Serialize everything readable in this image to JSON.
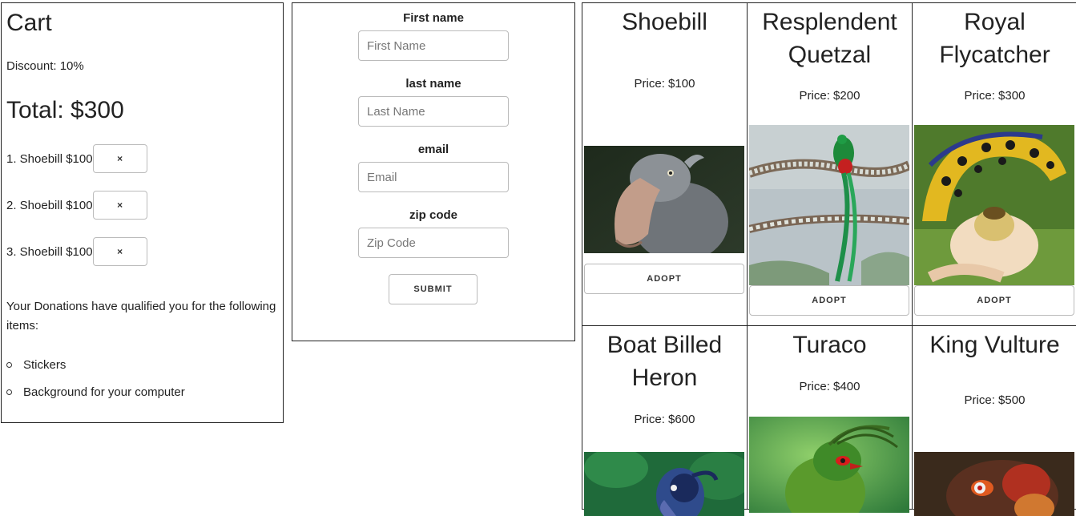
{
  "cart": {
    "title": "Cart",
    "discount": "Discount: 10%",
    "total": "Total: $300",
    "remove_symbol": "×",
    "items": [
      {
        "label": "1. Shoebill $100"
      },
      {
        "label": "2. Shoebill $100"
      },
      {
        "label": "3. Shoebill $100"
      }
    ],
    "qualify_text": "Your Donations have qualified you for the following items:",
    "rewards": [
      "Stickers",
      "Background for your computer"
    ]
  },
  "form": {
    "first_name_label": "First name",
    "first_name_placeholder": "First Name",
    "last_name_label": "last name",
    "last_name_placeholder": "Last Name",
    "email_label": "email",
    "email_placeholder": "Email",
    "zip_label": "zip code",
    "zip_placeholder": "Zip Code",
    "submit_label": "SUBMIT"
  },
  "birds": [
    {
      "name": "Shoebill",
      "price": "Price: $100",
      "adopt": "ADOPT"
    },
    {
      "name": "Resplendent Quetzal",
      "price": "Price: $200",
      "adopt": "ADOPT"
    },
    {
      "name": "Royal Flycatcher",
      "price": "Price: $300",
      "adopt": "ADOPT"
    },
    {
      "name": "Boat Billed Heron",
      "price": "Price: $600"
    },
    {
      "name": "Turaco",
      "price": "Price: $400"
    },
    {
      "name": "King Vulture",
      "price": "Price: $500"
    }
  ]
}
